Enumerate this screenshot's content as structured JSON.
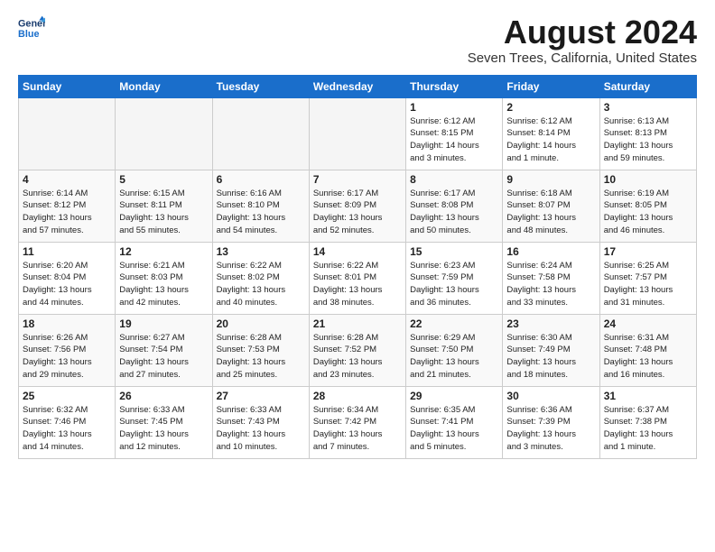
{
  "header": {
    "logo_line1": "General",
    "logo_line2": "Blue",
    "month_year": "August 2024",
    "location": "Seven Trees, California, United States"
  },
  "days_of_week": [
    "Sunday",
    "Monday",
    "Tuesday",
    "Wednesday",
    "Thursday",
    "Friday",
    "Saturday"
  ],
  "weeks": [
    [
      {
        "day": "",
        "info": ""
      },
      {
        "day": "",
        "info": ""
      },
      {
        "day": "",
        "info": ""
      },
      {
        "day": "",
        "info": ""
      },
      {
        "day": "1",
        "info": "Sunrise: 6:12 AM\nSunset: 8:15 PM\nDaylight: 14 hours\nand 3 minutes."
      },
      {
        "day": "2",
        "info": "Sunrise: 6:12 AM\nSunset: 8:14 PM\nDaylight: 14 hours\nand 1 minute."
      },
      {
        "day": "3",
        "info": "Sunrise: 6:13 AM\nSunset: 8:13 PM\nDaylight: 13 hours\nand 59 minutes."
      }
    ],
    [
      {
        "day": "4",
        "info": "Sunrise: 6:14 AM\nSunset: 8:12 PM\nDaylight: 13 hours\nand 57 minutes."
      },
      {
        "day": "5",
        "info": "Sunrise: 6:15 AM\nSunset: 8:11 PM\nDaylight: 13 hours\nand 55 minutes."
      },
      {
        "day": "6",
        "info": "Sunrise: 6:16 AM\nSunset: 8:10 PM\nDaylight: 13 hours\nand 54 minutes."
      },
      {
        "day": "7",
        "info": "Sunrise: 6:17 AM\nSunset: 8:09 PM\nDaylight: 13 hours\nand 52 minutes."
      },
      {
        "day": "8",
        "info": "Sunrise: 6:17 AM\nSunset: 8:08 PM\nDaylight: 13 hours\nand 50 minutes."
      },
      {
        "day": "9",
        "info": "Sunrise: 6:18 AM\nSunset: 8:07 PM\nDaylight: 13 hours\nand 48 minutes."
      },
      {
        "day": "10",
        "info": "Sunrise: 6:19 AM\nSunset: 8:05 PM\nDaylight: 13 hours\nand 46 minutes."
      }
    ],
    [
      {
        "day": "11",
        "info": "Sunrise: 6:20 AM\nSunset: 8:04 PM\nDaylight: 13 hours\nand 44 minutes."
      },
      {
        "day": "12",
        "info": "Sunrise: 6:21 AM\nSunset: 8:03 PM\nDaylight: 13 hours\nand 42 minutes."
      },
      {
        "day": "13",
        "info": "Sunrise: 6:22 AM\nSunset: 8:02 PM\nDaylight: 13 hours\nand 40 minutes."
      },
      {
        "day": "14",
        "info": "Sunrise: 6:22 AM\nSunset: 8:01 PM\nDaylight: 13 hours\nand 38 minutes."
      },
      {
        "day": "15",
        "info": "Sunrise: 6:23 AM\nSunset: 7:59 PM\nDaylight: 13 hours\nand 36 minutes."
      },
      {
        "day": "16",
        "info": "Sunrise: 6:24 AM\nSunset: 7:58 PM\nDaylight: 13 hours\nand 33 minutes."
      },
      {
        "day": "17",
        "info": "Sunrise: 6:25 AM\nSunset: 7:57 PM\nDaylight: 13 hours\nand 31 minutes."
      }
    ],
    [
      {
        "day": "18",
        "info": "Sunrise: 6:26 AM\nSunset: 7:56 PM\nDaylight: 13 hours\nand 29 minutes."
      },
      {
        "day": "19",
        "info": "Sunrise: 6:27 AM\nSunset: 7:54 PM\nDaylight: 13 hours\nand 27 minutes."
      },
      {
        "day": "20",
        "info": "Sunrise: 6:28 AM\nSunset: 7:53 PM\nDaylight: 13 hours\nand 25 minutes."
      },
      {
        "day": "21",
        "info": "Sunrise: 6:28 AM\nSunset: 7:52 PM\nDaylight: 13 hours\nand 23 minutes."
      },
      {
        "day": "22",
        "info": "Sunrise: 6:29 AM\nSunset: 7:50 PM\nDaylight: 13 hours\nand 21 minutes."
      },
      {
        "day": "23",
        "info": "Sunrise: 6:30 AM\nSunset: 7:49 PM\nDaylight: 13 hours\nand 18 minutes."
      },
      {
        "day": "24",
        "info": "Sunrise: 6:31 AM\nSunset: 7:48 PM\nDaylight: 13 hours\nand 16 minutes."
      }
    ],
    [
      {
        "day": "25",
        "info": "Sunrise: 6:32 AM\nSunset: 7:46 PM\nDaylight: 13 hours\nand 14 minutes."
      },
      {
        "day": "26",
        "info": "Sunrise: 6:33 AM\nSunset: 7:45 PM\nDaylight: 13 hours\nand 12 minutes."
      },
      {
        "day": "27",
        "info": "Sunrise: 6:33 AM\nSunset: 7:43 PM\nDaylight: 13 hours\nand 10 minutes."
      },
      {
        "day": "28",
        "info": "Sunrise: 6:34 AM\nSunset: 7:42 PM\nDaylight: 13 hours\nand 7 minutes."
      },
      {
        "day": "29",
        "info": "Sunrise: 6:35 AM\nSunset: 7:41 PM\nDaylight: 13 hours\nand 5 minutes."
      },
      {
        "day": "30",
        "info": "Sunrise: 6:36 AM\nSunset: 7:39 PM\nDaylight: 13 hours\nand 3 minutes."
      },
      {
        "day": "31",
        "info": "Sunrise: 6:37 AM\nSunset: 7:38 PM\nDaylight: 13 hours\nand 1 minute."
      }
    ]
  ]
}
